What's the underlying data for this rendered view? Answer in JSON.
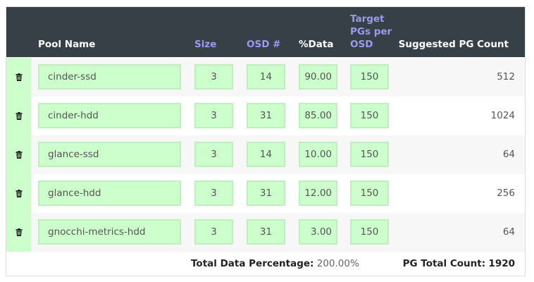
{
  "headers": {
    "pool_name": "Pool Name",
    "size": "Size",
    "osd": "OSD #",
    "data": "%Data",
    "target_l1": "Target",
    "target_l2": "PGs per",
    "target_l3": "OSD",
    "suggested": "Suggested PG Count"
  },
  "rows": [
    {
      "pool": "cinder-ssd",
      "size": "3",
      "osd": "14",
      "data": "90.00",
      "target": "150",
      "suggested": "512"
    },
    {
      "pool": "cinder-hdd",
      "size": "3",
      "osd": "31",
      "data": "85.00",
      "target": "150",
      "suggested": "1024"
    },
    {
      "pool": "glance-ssd",
      "size": "3",
      "osd": "14",
      "data": "10.00",
      "target": "150",
      "suggested": "64"
    },
    {
      "pool": "glance-hdd",
      "size": "3",
      "osd": "31",
      "data": "12.00",
      "target": "150",
      "suggested": "256"
    },
    {
      "pool": "gnocchi-metrics-hdd",
      "size": "3",
      "osd": "31",
      "data": "3.00",
      "target": "150",
      "suggested": "64"
    }
  ],
  "footer": {
    "total_data_label": "Total Data Percentage:",
    "total_data_value": "200.00%",
    "pg_total_label": "PG Total Count:",
    "pg_total_value": "1920"
  },
  "icons": {
    "delete": "trash-icon"
  },
  "colors": {
    "header_bg": "#374047",
    "link_header": "#9a9af0",
    "input_bg": "#ccffcc"
  }
}
